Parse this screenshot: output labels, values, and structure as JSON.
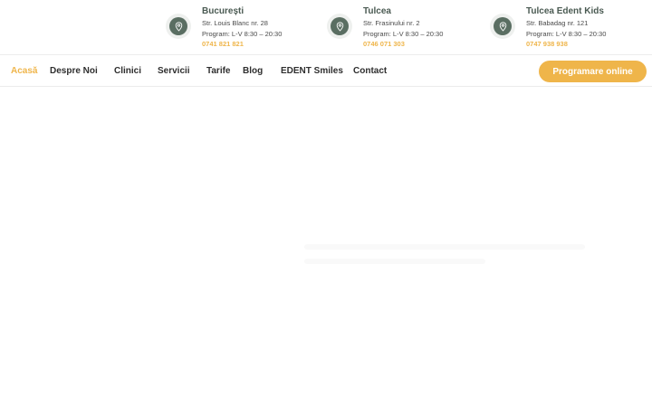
{
  "locations": [
    {
      "name": "București",
      "address": "Str. Louis Blanc nr. 28",
      "schedule": "Program: L-V 8:30 – 20:30",
      "phone": "0741 821 821",
      "icon": "map-pin-icon"
    },
    {
      "name": "Tulcea",
      "address": "Str. Frasinului nr. 2",
      "schedule": "Program: L-V 8:30 – 20:30",
      "phone": "0746 071 303",
      "icon": "map-pin-icon"
    },
    {
      "name": "Tulcea Edent Kids",
      "address": "Str. Babadag nr. 121",
      "schedule": "Program: L-V 8:30 – 20:30",
      "phone": "0747 938 938",
      "icon": "map-pin-icon"
    }
  ],
  "nav": {
    "items": [
      "Acasă",
      "Despre Noi",
      "Clinici",
      "Servicii",
      "Tarife",
      "Blog",
      "EDENT Smiles",
      "Contact"
    ],
    "active": "Acasă",
    "cta": "Programare online"
  },
  "colors": {
    "accent": "#efb54a",
    "icon_green": "#5a6e62",
    "text_dark": "#2e2e2e"
  }
}
